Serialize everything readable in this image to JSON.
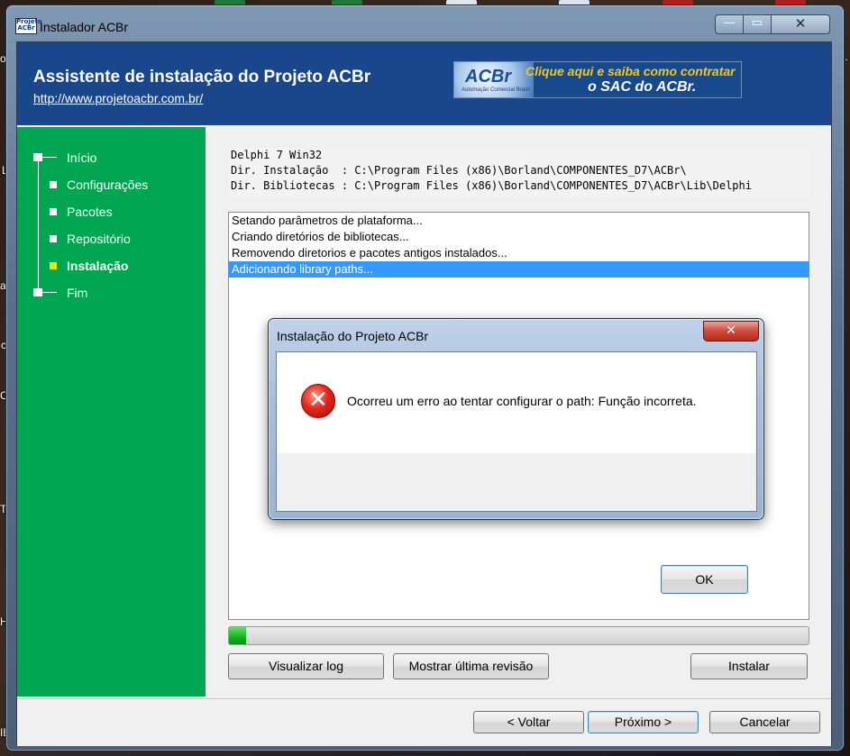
{
  "desktop": {
    "icons": [
      {
        "name": "excel-icon",
        "color": "#1f7a3a"
      },
      {
        "name": "excel-icon",
        "color": "#1f7a3a"
      },
      {
        "name": "document-icon",
        "color": "#dfe6f0"
      },
      {
        "name": "word-icon",
        "color": "#d9e3f3"
      },
      {
        "name": "pdf-icon",
        "color": "#b51d1d"
      },
      {
        "name": "pdf-icon",
        "color": "#b51d1d"
      }
    ],
    "right_label": "a...",
    "left_labels": [
      "on",
      "L",
      "an",
      "c",
      "CZ",
      "TN",
      "He",
      "IB"
    ]
  },
  "window": {
    "title": "Instalador ACBr",
    "logo_text": "Projeto ACBr",
    "minimize_glyph": "—",
    "maximize_glyph": "▭",
    "close_glyph": "✕"
  },
  "header": {
    "title": "Assistente de instalação do Projeto ACBr",
    "link": "http://www.projetoacbr.com.br/",
    "banner": {
      "logo": "ACBr",
      "logo_sub": "Automação Comercial Brasil",
      "line1": "Clique aqui e saiba como contratar",
      "line2": "o SAC do ACBr."
    }
  },
  "steps": [
    {
      "label": "Início",
      "active": false
    },
    {
      "label": "Configurações",
      "active": false
    },
    {
      "label": "Pacotes",
      "active": false
    },
    {
      "label": "Repositório",
      "active": false
    },
    {
      "label": "Instalação",
      "active": true
    },
    {
      "label": "Fim",
      "active": false
    }
  ],
  "info_lines": [
    "Delphi 7 Win32",
    "Dir. Instalação  : C:\\Program Files (x86)\\Borland\\COMPONENTES_D7\\ACBr\\",
    "Dir. Bibliotecas : C:\\Program Files (x86)\\Borland\\COMPONENTES_D7\\ACBr\\Lib\\Delphi"
  ],
  "log": [
    {
      "text": "Setando parâmetros de plataforma...",
      "selected": false
    },
    {
      "text": "Criando diretórios de bibliotecas...",
      "selected": false
    },
    {
      "text": "Removendo diretorios e pacotes antigos instalados...",
      "selected": false
    },
    {
      "text": "Adicionando library paths...",
      "selected": true
    }
  ],
  "progress": {
    "value": 0.03
  },
  "buttons": {
    "view_log": "Visualizar log",
    "show_revision": "Mostrar última revisão",
    "install": "Instalar",
    "back": "< Voltar",
    "next": "Próximo >",
    "cancel": "Cancelar"
  },
  "dialog": {
    "title": "Instalação do Projeto ACBr",
    "close_glyph": "✕",
    "icon": "error-icon",
    "icon_glyph": "✕",
    "message": "Ocorreu um erro ao tentar configurar o path: Função incorreta.",
    "ok": "OK"
  },
  "colors": {
    "header_bg": "#1a468c",
    "side_panel": "#00a651",
    "active_step": "#f2e600",
    "selection": "#3399ff",
    "progress": "#14b31f"
  }
}
